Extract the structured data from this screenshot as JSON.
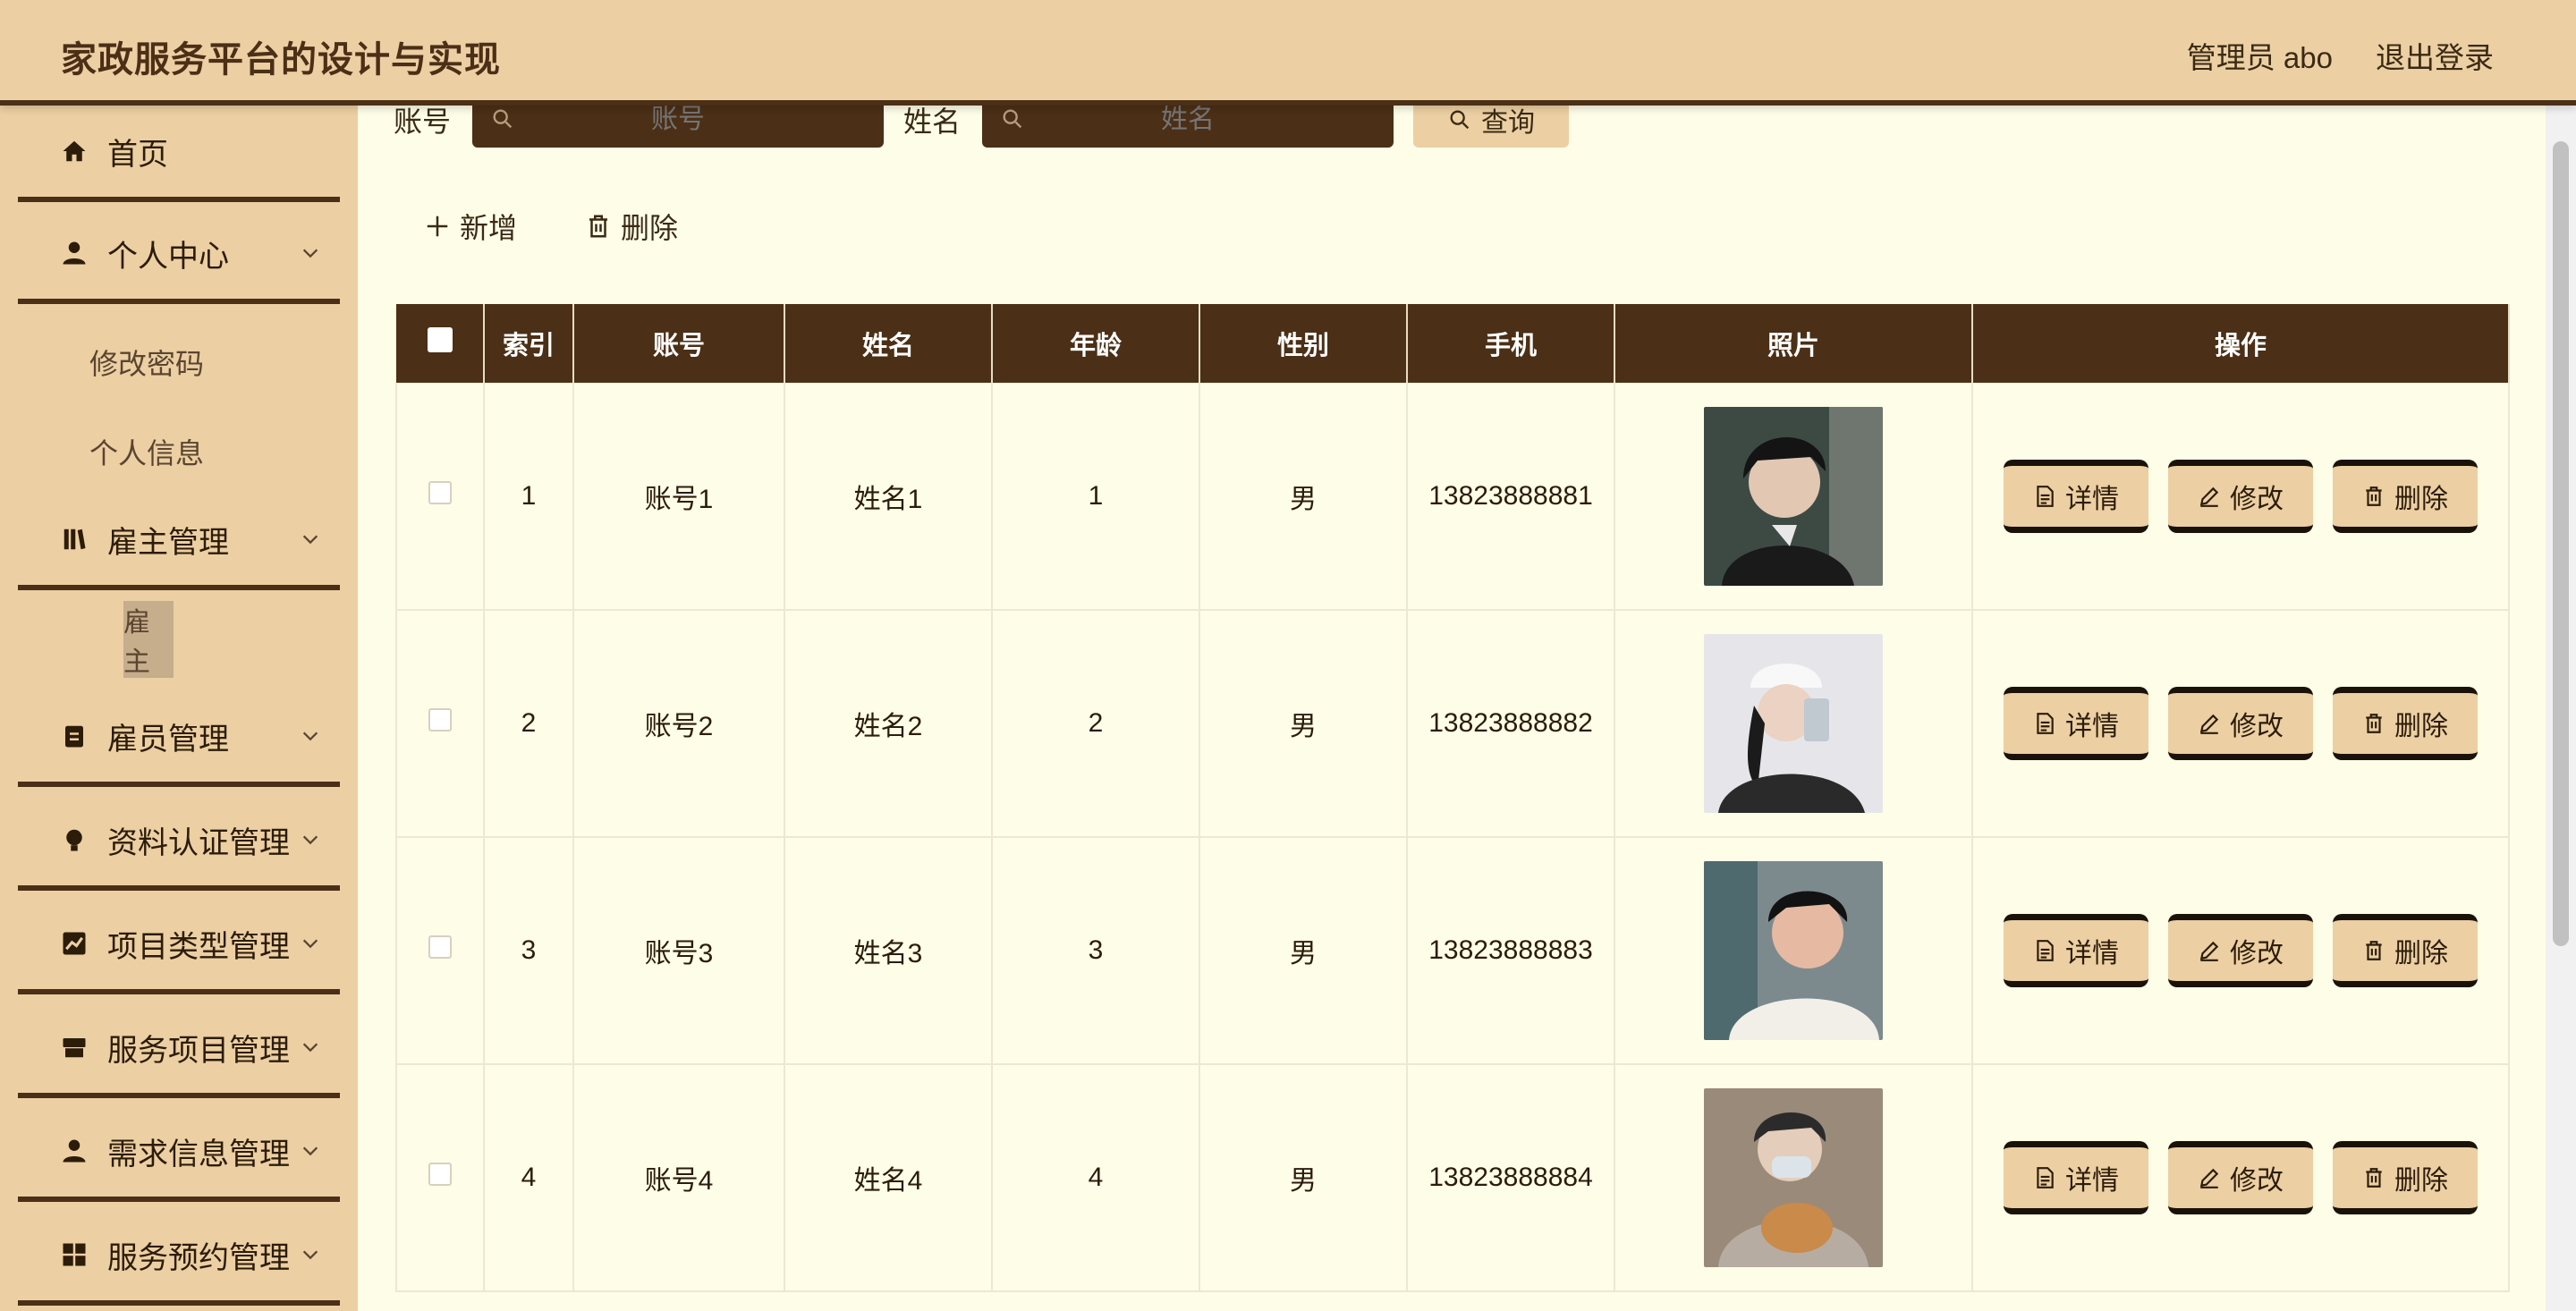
{
  "header": {
    "title": "家政服务平台的设计与实现",
    "user": "管理员 abo",
    "logout": "退出登录"
  },
  "sidebar": {
    "items": [
      {
        "label": "首页"
      },
      {
        "label": "个人中心"
      },
      {
        "label": "修改密码"
      },
      {
        "label": "个人信息"
      },
      {
        "label": "雇主管理"
      },
      {
        "label": "雇主"
      },
      {
        "label": "雇员管理"
      },
      {
        "label": "资料认证管理"
      },
      {
        "label": "项目类型管理"
      },
      {
        "label": "服务项目管理"
      },
      {
        "label": "需求信息管理"
      },
      {
        "label": "服务预约管理"
      }
    ]
  },
  "search": {
    "account_label": "账号",
    "account_placeholder": "账号",
    "name_label": "姓名",
    "name_placeholder": "姓名",
    "query_button": "查询"
  },
  "actions": {
    "add": "新增",
    "delete": "删除"
  },
  "table": {
    "columns": [
      "索引",
      "账号",
      "姓名",
      "年龄",
      "性别",
      "手机",
      "照片",
      "操作"
    ],
    "rows": [
      {
        "index": "1",
        "account": "账号1",
        "name": "姓名1",
        "age": "1",
        "gender": "男",
        "phone": "13823888881"
      },
      {
        "index": "2",
        "account": "账号2",
        "name": "姓名2",
        "age": "2",
        "gender": "男",
        "phone": "13823888882"
      },
      {
        "index": "3",
        "account": "账号3",
        "name": "姓名3",
        "age": "3",
        "gender": "男",
        "phone": "13823888883"
      },
      {
        "index": "4",
        "account": "账号4",
        "name": "姓名4",
        "age": "4",
        "gender": "男",
        "phone": "13823888884"
      }
    ],
    "row_buttons": {
      "detail": "详情",
      "edit": "修改",
      "delete": "删除"
    }
  },
  "colors": {
    "header_bg": "#eccfa3",
    "dark_brown": "#4b2f16",
    "content_bg": "#fefde8"
  }
}
